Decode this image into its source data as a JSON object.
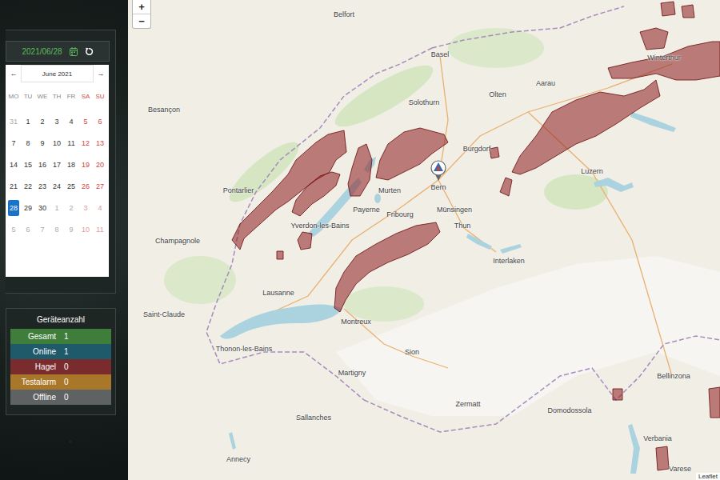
{
  "date_picker": {
    "value": "2021/06/28",
    "month_label": "June 2021",
    "prev": "←",
    "next": "→",
    "weekdays": [
      {
        "label": "MO",
        "weekend": false
      },
      {
        "label": "TU",
        "weekend": false
      },
      {
        "label": "WE",
        "weekend": false
      },
      {
        "label": "TH",
        "weekend": false
      },
      {
        "label": "FR",
        "weekend": false
      },
      {
        "label": "SA",
        "weekend": true
      },
      {
        "label": "SU",
        "weekend": true
      }
    ],
    "weeks": [
      [
        {
          "day": "31",
          "muted": true,
          "weekend": false,
          "selected": false
        },
        {
          "day": "1",
          "muted": false,
          "weekend": false,
          "selected": false
        },
        {
          "day": "2",
          "muted": false,
          "weekend": false,
          "selected": false
        },
        {
          "day": "3",
          "muted": false,
          "weekend": false,
          "selected": false
        },
        {
          "day": "4",
          "muted": false,
          "weekend": false,
          "selected": false
        },
        {
          "day": "5",
          "muted": false,
          "weekend": true,
          "selected": false
        },
        {
          "day": "6",
          "muted": false,
          "weekend": true,
          "selected": false
        }
      ],
      [
        {
          "day": "7",
          "muted": false,
          "weekend": false,
          "selected": false
        },
        {
          "day": "8",
          "muted": false,
          "weekend": false,
          "selected": false
        },
        {
          "day": "9",
          "muted": false,
          "weekend": false,
          "selected": false
        },
        {
          "day": "10",
          "muted": false,
          "weekend": false,
          "selected": false
        },
        {
          "day": "11",
          "muted": false,
          "weekend": false,
          "selected": false
        },
        {
          "day": "12",
          "muted": false,
          "weekend": true,
          "selected": false
        },
        {
          "day": "13",
          "muted": false,
          "weekend": true,
          "selected": false
        }
      ],
      [
        {
          "day": "14",
          "muted": false,
          "weekend": false,
          "selected": false
        },
        {
          "day": "15",
          "muted": false,
          "weekend": false,
          "selected": false
        },
        {
          "day": "16",
          "muted": false,
          "weekend": false,
          "selected": false
        },
        {
          "day": "17",
          "muted": false,
          "weekend": false,
          "selected": false
        },
        {
          "day": "18",
          "muted": false,
          "weekend": false,
          "selected": false
        },
        {
          "day": "19",
          "muted": false,
          "weekend": true,
          "selected": false
        },
        {
          "day": "20",
          "muted": false,
          "weekend": true,
          "selected": false
        }
      ],
      [
        {
          "day": "21",
          "muted": false,
          "weekend": false,
          "selected": false
        },
        {
          "day": "22",
          "muted": false,
          "weekend": false,
          "selected": false
        },
        {
          "day": "23",
          "muted": false,
          "weekend": false,
          "selected": false
        },
        {
          "day": "24",
          "muted": false,
          "weekend": false,
          "selected": false
        },
        {
          "day": "25",
          "muted": false,
          "weekend": false,
          "selected": false
        },
        {
          "day": "26",
          "muted": false,
          "weekend": true,
          "selected": false
        },
        {
          "day": "27",
          "muted": false,
          "weekend": true,
          "selected": false
        }
      ],
      [
        {
          "day": "28",
          "muted": false,
          "weekend": false,
          "selected": true
        },
        {
          "day": "29",
          "muted": false,
          "weekend": false,
          "selected": false
        },
        {
          "day": "30",
          "muted": false,
          "weekend": false,
          "selected": false
        },
        {
          "day": "1",
          "muted": true,
          "weekend": false,
          "selected": false
        },
        {
          "day": "2",
          "muted": true,
          "weekend": false,
          "selected": false
        },
        {
          "day": "3",
          "muted": true,
          "weekend": true,
          "selected": false
        },
        {
          "day": "4",
          "muted": true,
          "weekend": true,
          "selected": false
        }
      ],
      [
        {
          "day": "5",
          "muted": true,
          "weekend": false,
          "selected": false
        },
        {
          "day": "6",
          "muted": true,
          "weekend": false,
          "selected": false
        },
        {
          "day": "7",
          "muted": true,
          "weekend": false,
          "selected": false
        },
        {
          "day": "8",
          "muted": true,
          "weekend": false,
          "selected": false
        },
        {
          "day": "9",
          "muted": true,
          "weekend": false,
          "selected": false
        },
        {
          "day": "10",
          "muted": true,
          "weekend": true,
          "selected": false
        },
        {
          "day": "11",
          "muted": true,
          "weekend": true,
          "selected": false
        }
      ]
    ]
  },
  "device_counts": {
    "title": "Geräteanzahl",
    "rows": [
      {
        "label": "Gesamt",
        "count": "1",
        "color": "#3f7d3a"
      },
      {
        "label": "Online",
        "count": "1",
        "color": "#1f5a6b"
      },
      {
        "label": "Hagel",
        "count": "0",
        "color": "#7a2b2e"
      },
      {
        "label": "Testalarm",
        "count": "0",
        "color": "#a9772a"
      },
      {
        "label": "Offline",
        "count": "0",
        "color": "#5f6262"
      }
    ]
  },
  "map": {
    "zoom_in": "+",
    "zoom_out": "−",
    "attribution": "Leaflet",
    "labels": [
      "Belfort",
      "Basel",
      "Winterthur",
      "Besançon",
      "Solothurn",
      "Olten",
      "Aarau",
      "Burgdorf",
      "Bern",
      "Münsingen",
      "Thun",
      "Interlaken",
      "Luzern",
      "Pontarlier",
      "Yverdon-les-Bains",
      "Murten",
      "Payerne",
      "Fribourg",
      "Champagnole",
      "Lausanne",
      "Montreux",
      "Thonon-les-Bains",
      "Saint-Claude",
      "Annecy",
      "Sallanches",
      "Martigny",
      "Sion",
      "Zermatt",
      "Domodossola",
      "Bellinzona",
      "Verbania",
      "Varese"
    ]
  }
}
